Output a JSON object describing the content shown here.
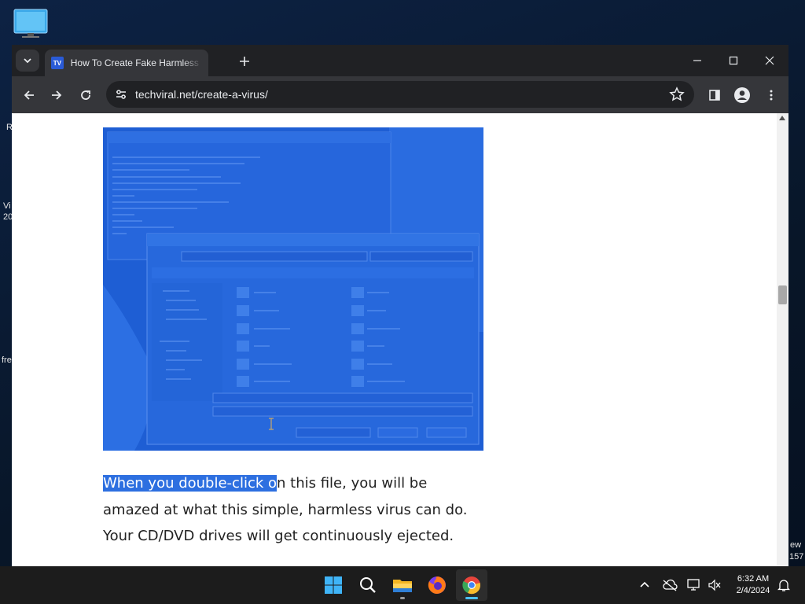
{
  "desktop": {
    "side_labels": [
      "R",
      "Vi",
      "20",
      "fre",
      "ew",
      "157"
    ]
  },
  "browser": {
    "tab": {
      "favicon_text": "TV",
      "title": "How To Create Fake Harmless V"
    },
    "url": "techviral.net/create-a-virus/",
    "window_controls": {
      "minimize": "minimize-icon",
      "maximize": "maximize-icon",
      "close": "close-icon"
    }
  },
  "article": {
    "image_alt": "Notepad script with Save As dialog",
    "paragraph_highlighted": "When you double-click o",
    "paragraph_rest": "n this file, you will be amazed at what this simple, harmless virus can do. Your CD/DVD drives will get continuously ejected."
  },
  "taskbar": {
    "apps": [
      "start-icon",
      "search-icon",
      "file-explorer-icon",
      "firefox-icon",
      "chrome-icon"
    ],
    "clock": {
      "time": "6:32 AM",
      "date": "2/4/2024"
    }
  },
  "colors": {
    "accent": "#2d6fe0",
    "tab_bg": "#35363a",
    "frame_bg": "#202124",
    "taskbar_bg": "#1c1c1c"
  }
}
